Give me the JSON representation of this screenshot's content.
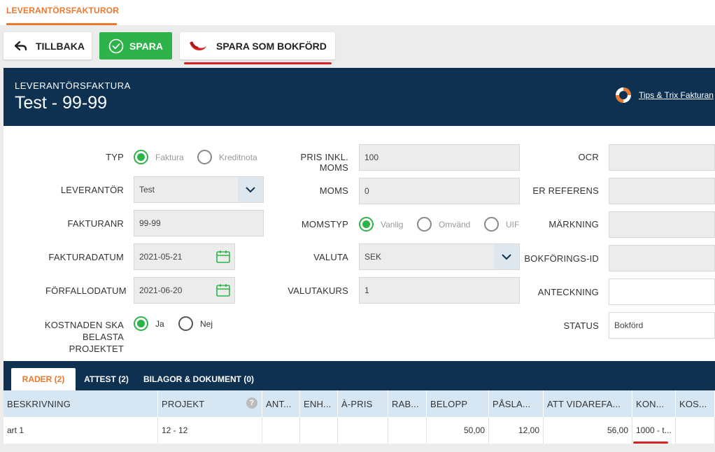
{
  "nav": {
    "tab": "LEVERANTÖRSFAKTUROR"
  },
  "toolbar": {
    "back_label": "TILLBAKA",
    "save_label": "SPARA",
    "save_booked_label": "SPARA SOM BOKFÖRD"
  },
  "header": {
    "subtitle": "LEVERANTÖRSFAKTURA",
    "title": "Test - 99-99",
    "tips_link": "Tips & Trix Fakturan"
  },
  "form": {
    "typ": {
      "label": "TYP",
      "options": [
        "Faktura",
        "Kreditnota"
      ],
      "selected": "Faktura"
    },
    "leverantor": {
      "label": "LEVERANTÖR",
      "value": "Test"
    },
    "fakturanr": {
      "label": "FAKTURANR",
      "value": "99-99"
    },
    "fakturadatum": {
      "label": "FAKTURADATUM",
      "value": "2021-05-21"
    },
    "forfallodatum": {
      "label": "FÖRFALLODATUM",
      "value": "2021-06-20"
    },
    "kostnaden": {
      "label_line1": "KOSTNADEN SKA BELASTA",
      "label_line2": "PROJEKTET",
      "options": [
        "Ja",
        "Nej"
      ],
      "selected": "Ja"
    },
    "pris_inkl_moms": {
      "label": "PRIS INKL. MOMS",
      "value": "100"
    },
    "moms": {
      "label": "MOMS",
      "value": "0"
    },
    "momstyp": {
      "label": "MOMSTYP",
      "options": [
        "Vanlig",
        "Omvänd",
        "UIF"
      ],
      "selected": "Vanlig"
    },
    "valuta": {
      "label": "VALUTA",
      "value": "SEK"
    },
    "valutakurs": {
      "label": "VALUTAKURS",
      "value": "1"
    },
    "ocr": {
      "label": "OCR",
      "value": ""
    },
    "er_referens": {
      "label": "ER REFERENS",
      "value": ""
    },
    "markning": {
      "label": "MÄRKNING",
      "value": ""
    },
    "bokforings_id": {
      "label": "BOKFÖRINGS-ID",
      "value": ""
    },
    "anteckning": {
      "label": "ANTECKNING",
      "value": ""
    },
    "status": {
      "label": "STATUS",
      "value": "Bokförd"
    }
  },
  "tabs": [
    "RADER (2)",
    "ATTEST (2)",
    "BILAGOR & DOKUMENT (0)"
  ],
  "table": {
    "columns": [
      "BESKRIVNING",
      "PROJEKT",
      "ANT...",
      "ENH...",
      "À-PRIS",
      "RAB...",
      "BELOPP",
      "PÅSLA...",
      "ATT VIDAREFA...",
      "KON...",
      "KOS..."
    ],
    "help_icon": "?",
    "rows": [
      [
        "art 1",
        "12 - 12",
        "",
        "",
        "",
        "",
        "50,00",
        "12,00",
        "56,00",
        "1000 - t...",
        ""
      ]
    ]
  },
  "colors": {
    "accent": "#e8792e",
    "header_bg": "#0e3152",
    "success": "#2eb34a",
    "highlight": "#d42226"
  }
}
